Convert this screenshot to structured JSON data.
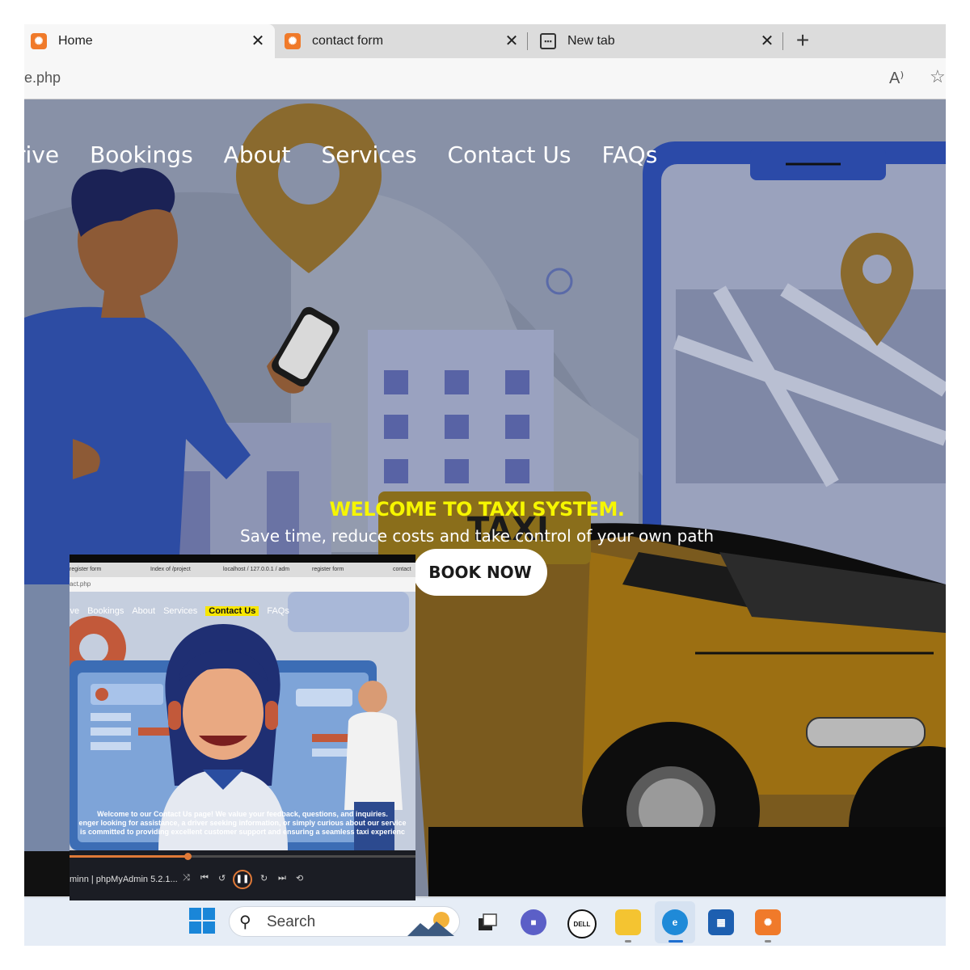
{
  "browser": {
    "tabs": [
      {
        "label": "Home",
        "icon": "xampp-icon",
        "active": true
      },
      {
        "label": "contact form",
        "icon": "xampp-icon",
        "active": false
      },
      {
        "label": "New tab",
        "icon": "new-tab-page-icon",
        "active": false
      }
    ],
    "close_glyph": "✕",
    "new_tab_glyph": "+",
    "url": "e.php",
    "read_aloud_glyph": "A⁾",
    "favorite_glyph": "☆"
  },
  "site": {
    "nav": [
      "rive",
      "Bookings",
      "About",
      "Services",
      "Contact Us",
      "FAQs"
    ],
    "hero_title": "WELCOME TO TAXI SYSTEM.",
    "hero_subtitle": "Save time, reduce costs and take control of your own path",
    "book_button": "BOOK NOW",
    "taxi_sign": "TAXI",
    "colors": {
      "welcome": "#f6f600",
      "overlay": "#8891a7",
      "taxi": "#e8a32a"
    }
  },
  "video_overlay": {
    "tabs": [
      "register form",
      "Index of /project",
      "localhost / 127.0.0.1 / adm",
      "register form",
      "contact"
    ],
    "url": "act.php",
    "nav": [
      "ive",
      "Bookings",
      "About",
      "Services",
      "Contact Us",
      "FAQs"
    ],
    "nav_highlight": "Contact Us",
    "message_lines": [
      "Welcome to our Contact Us page! We value your feedback, questions, and inquiries.",
      "enger looking for assistance, a driver seeking information, or simply curious about our service",
      " is committed to providing excellent customer support and ensuring a seamless taxi experienc"
    ],
    "progress": 0.34,
    "title": "minn | phpMyAdmin 5.2.1...",
    "controls": {
      "shuffle": "⤨",
      "prev": "⏮",
      "rewind": "↺",
      "pause": "❚❚",
      "forward": "↻",
      "next": "⏭",
      "repeat": "⟲"
    }
  },
  "taskbar": {
    "search_label": "Search",
    "search_glyph": "⚲",
    "apps": [
      "task-view-icon",
      "teams-chat-icon",
      "dell-icon",
      "file-explorer-icon",
      "edge-icon",
      "microsoft-store-icon",
      "xampp-icon"
    ],
    "dell_label": "DELL"
  }
}
